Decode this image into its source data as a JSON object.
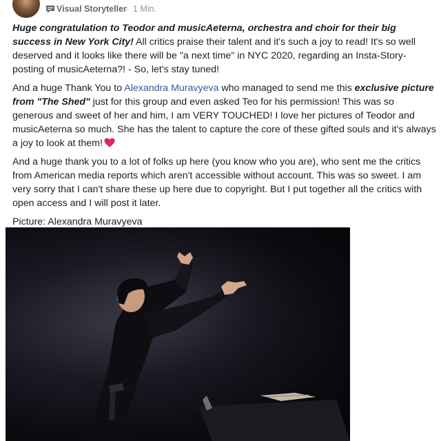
{
  "post": {
    "author_badge": "Visual Storyteller",
    "separator": "·",
    "timestamp": "1 Min.",
    "paragraphs": {
      "p1": {
        "bold": "Huge congratulation to Teodor and musicAeterna, orchestra and choir for their big success in New York City!",
        "rest": " All critics praise their talent and it's such a joy to read! It's so well deserved and it looks like there will be \"a next time\" in NYC 2020, regarding an Insta-Story-posting of musicAeterna?! - So, let's stay tuned!"
      },
      "p2": {
        "pre": "And a huge Thank You to ",
        "mention": "Alexandra Muravyeva",
        "mid": " who managed to send me this ",
        "bold1": "exclusive picture from \"The Shed\"",
        "rest": " just for this group and even asked Teo for his permission! This was so generous and sweet of her and him, I am VERY TOUCHED! I love her pictures of Teodor and musicAeterna so much. She has the talent to capture the core of these gifted souls and it's always a joy to look at them!"
      },
      "p3": "And a huge thank you to a lot of folks up here (you know who you are), who sent me the critics from American media reports which aren't accessible without account. This was so sweet. I am very sorry that I can't share these up here due to copyright. But I put together all the critics with open access and I will post it later.",
      "p4": "Picture: Alexandra Muravyeva"
    }
  },
  "icons": {
    "badge": "speech-bubble-icon",
    "heart": "red-heart-emoji"
  },
  "colors": {
    "link": "#385898",
    "heart": "#e0245e",
    "meta": "#90949c"
  }
}
